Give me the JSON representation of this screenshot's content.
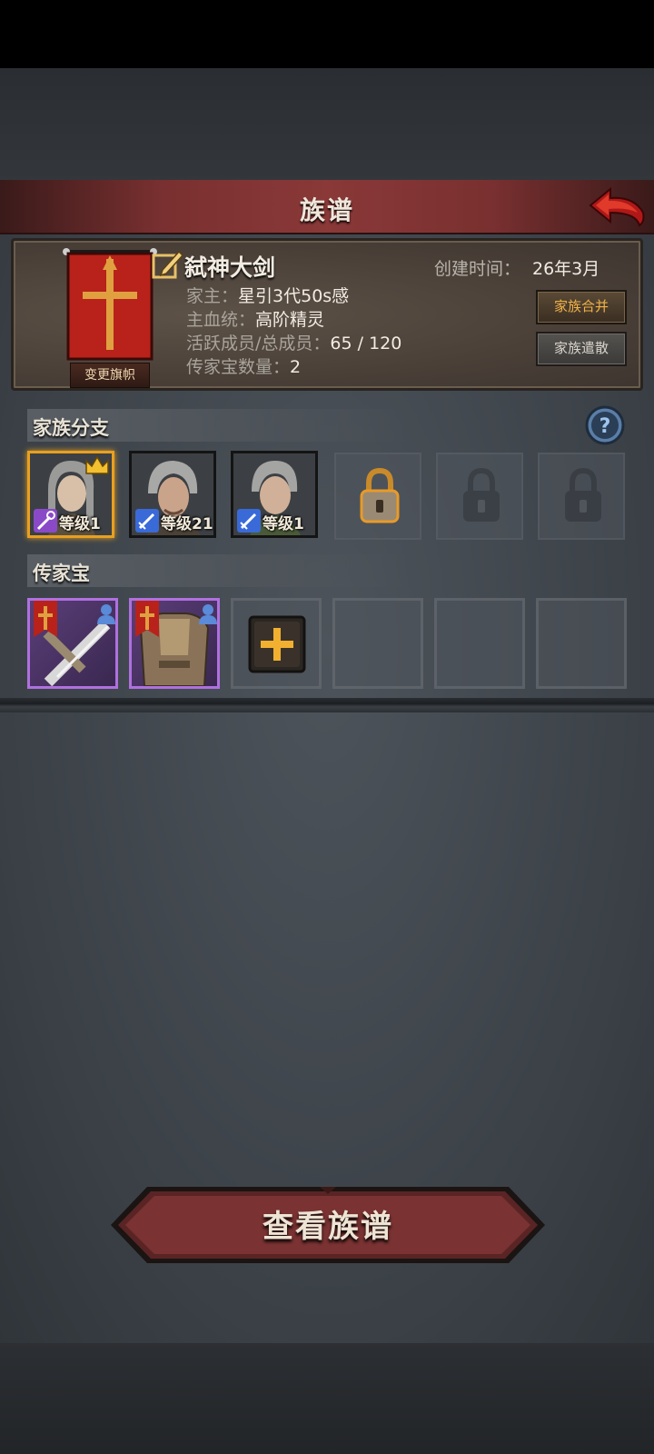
{
  "header": {
    "title": "族谱"
  },
  "family": {
    "name": "弑神大剑",
    "created_label": "创建时间：",
    "created_value": "26年3月",
    "patriarch_label": "家主：",
    "patriarch_value": "星引3代50s感",
    "bloodline_label": "主血统：",
    "bloodline_value": "高阶精灵",
    "members_label": "活跃成员/总成员：",
    "members_value": "65 / 120",
    "heirloom_count_label": "传家宝数量：",
    "heirloom_count_value": "2",
    "change_banner_label": "变更旗帜",
    "merge_label": "家族合并",
    "disband_label": "家族遣散"
  },
  "branches": {
    "title": "家族分支",
    "members": [
      {
        "level_text": "等级1",
        "class_icon": "staff-icon",
        "class_color": "#8a4ac8",
        "leader": true
      },
      {
        "level_text": "等级21",
        "class_icon": "sword-icon",
        "class_color": "#3a6ad8",
        "leader": false
      },
      {
        "level_text": "等级1",
        "class_icon": "sword-icon",
        "class_color": "#3a6ad8",
        "leader": false
      }
    ],
    "locked_slots": [
      "unlockable",
      "locked",
      "locked"
    ]
  },
  "heirlooms": {
    "title": "传家宝",
    "items": [
      {
        "kind": "greatsword",
        "rarity_color": "#b070e0"
      },
      {
        "kind": "armor",
        "rarity_color": "#b070e0"
      }
    ],
    "add_slot": "plus-icon",
    "empty_slots": 3
  },
  "footer": {
    "view_button_label": "查看族谱"
  },
  "colors": {
    "accent_gold": "#e8a020",
    "banner_red": "#b8221a",
    "epic_purple": "#b070e0"
  }
}
